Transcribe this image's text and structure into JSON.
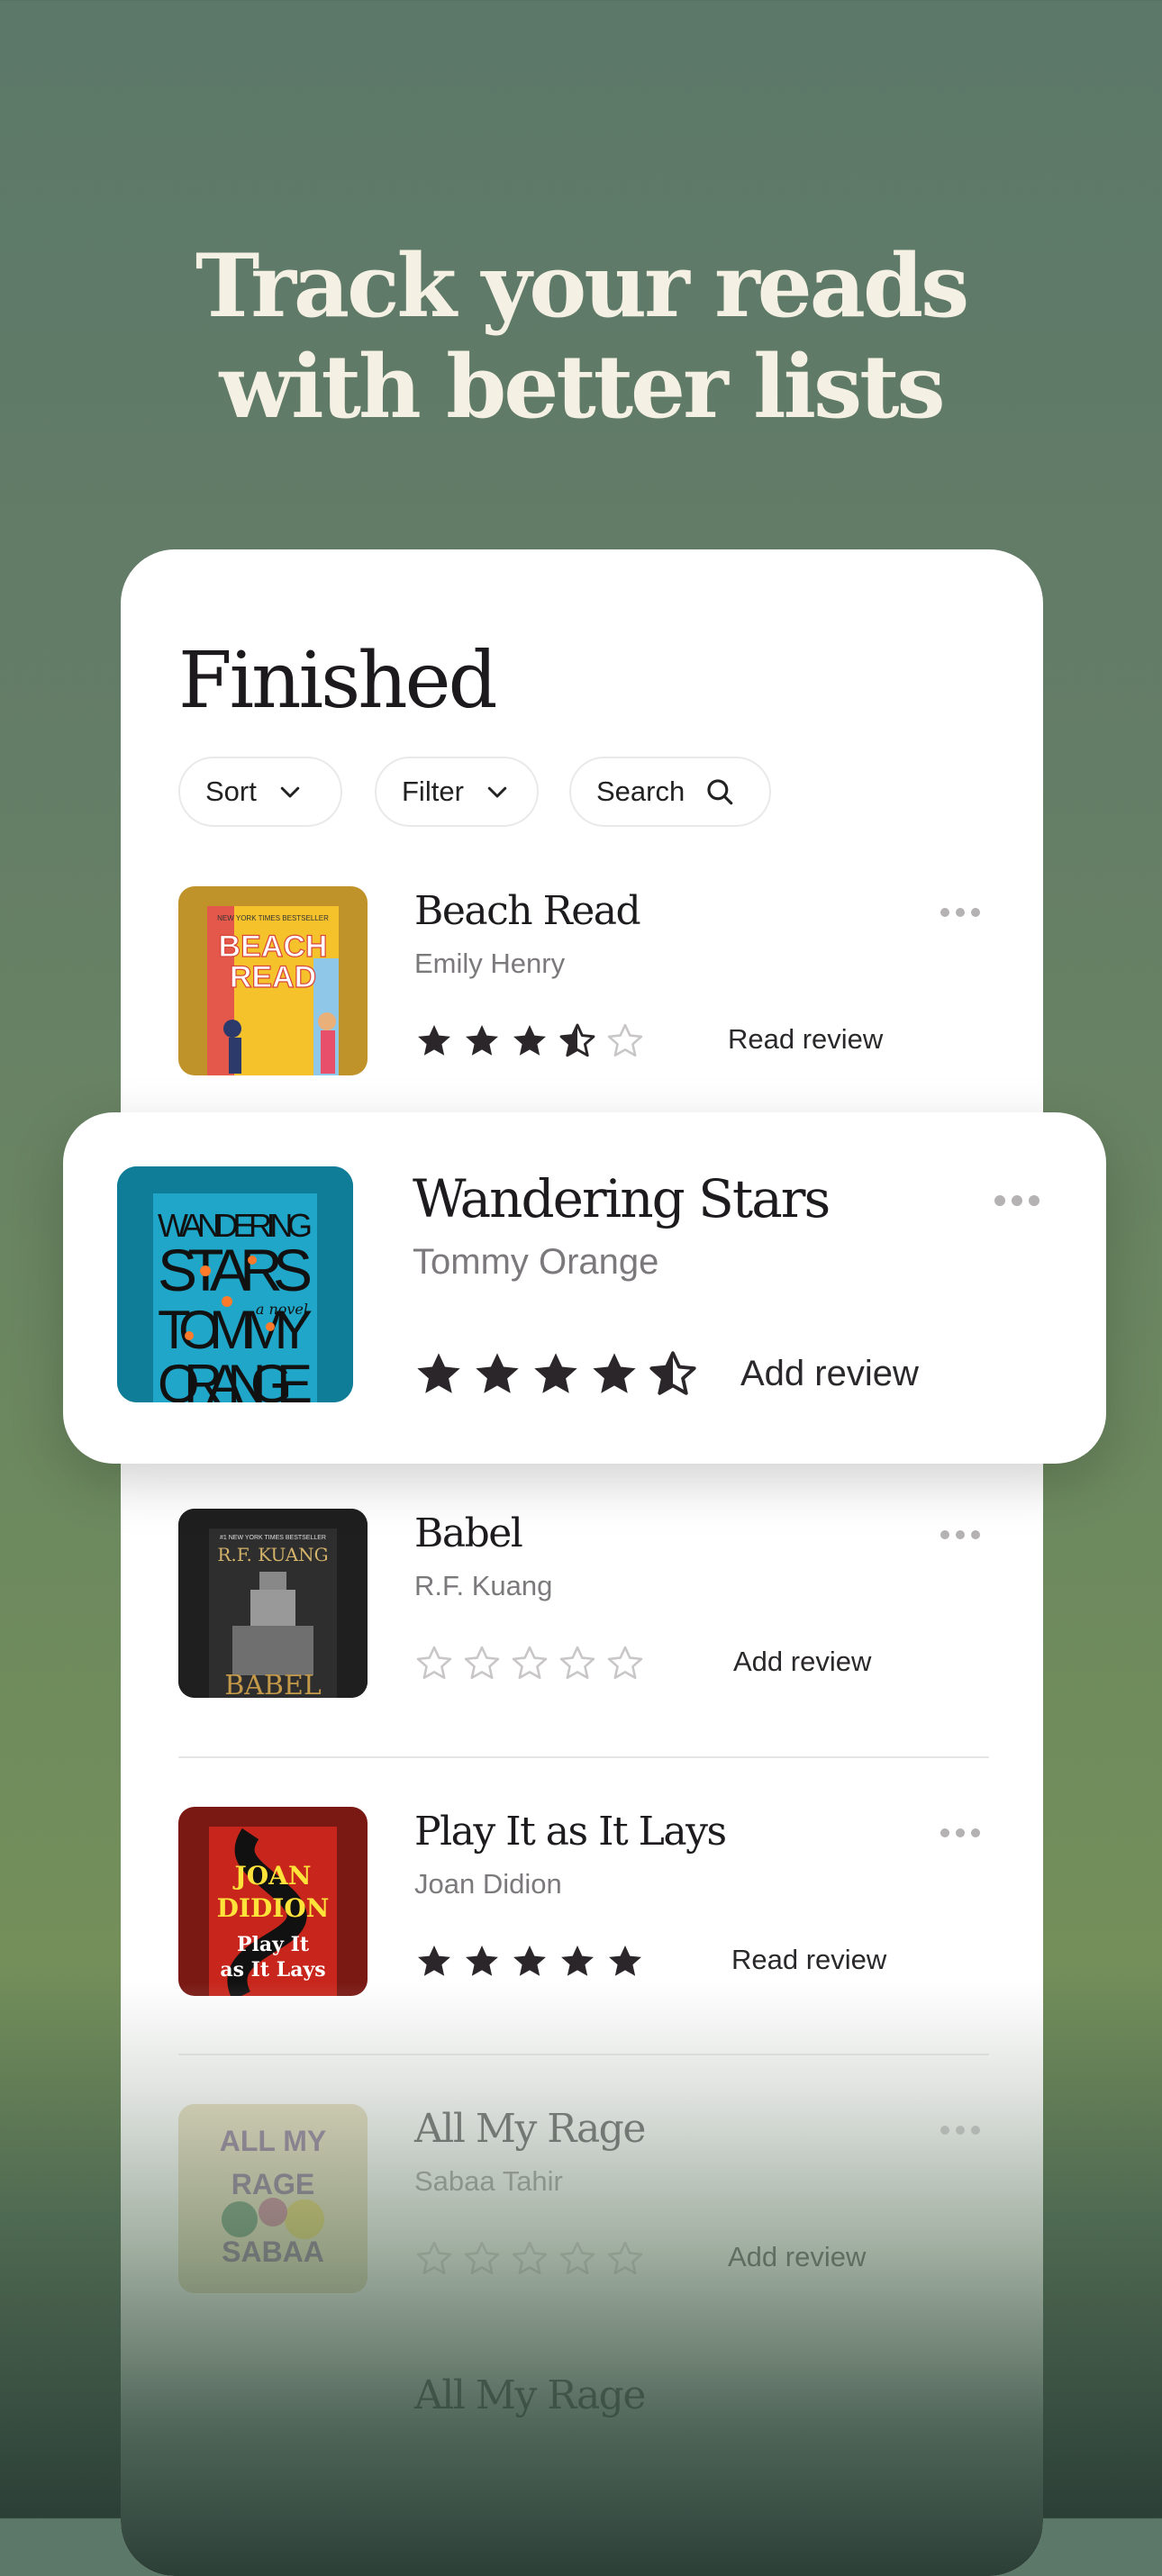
{
  "headline": {
    "line1": "Track your reads",
    "line2": "with better lists"
  },
  "list": {
    "title": "Finished",
    "controls": {
      "sort": "Sort",
      "filter": "Filter",
      "search": "Search"
    }
  },
  "books": [
    {
      "title": "Beach Read",
      "author": "Emily Henry",
      "rating": 3.5,
      "action": "Read review",
      "cover": {
        "bg": "#f5c22c",
        "frame": "#c0932a",
        "text_line1": "BEACH",
        "text_line2": "READ",
        "topline": "NEW YORK TIMES BESTSELLER"
      }
    },
    {
      "title": "Wandering Stars",
      "author": "Tommy Orange",
      "rating": 4.5,
      "action": "Add review",
      "cover": {
        "bg": "#20a6c8",
        "frame": "#0f7d97",
        "text_line1": "WANDERING",
        "text_line2": "STARS",
        "text_line3": "TOMMY",
        "text_line4": "ORANGE",
        "tag": "a novel"
      }
    },
    {
      "title": "Babel",
      "author": "R.F. Kuang",
      "rating": 0,
      "action": "Add review",
      "cover": {
        "bg": "#1f1f1f",
        "author_text": "R.F. KUANG",
        "title_text": "BABEL",
        "topline": "#1 NEW YORK TIMES BESTSELLER"
      }
    },
    {
      "title": "Play It as It Lays",
      "author": "Joan Didion",
      "rating": 5,
      "action": "Read review",
      "cover": {
        "bg": "#c8261c",
        "frame": "#7a1813",
        "text_line1": "JOAN",
        "text_line2": "DIDION",
        "text_line3": "Play It",
        "text_line4": "as It Lays"
      }
    },
    {
      "title": "All My Rage",
      "author": "Sabaa Tahir",
      "rating": 0,
      "action": "Add review",
      "cover": {
        "bg": "#d9cd9e",
        "text_line1": "ALL MY",
        "text_line2": "RAGE",
        "text_line3": "SABAA"
      }
    },
    {
      "title": "All My Rage"
    }
  ],
  "colors": {
    "star_filled": "#2a2629",
    "star_empty": "#c9c6c8",
    "headline": "#f5f0e4"
  }
}
